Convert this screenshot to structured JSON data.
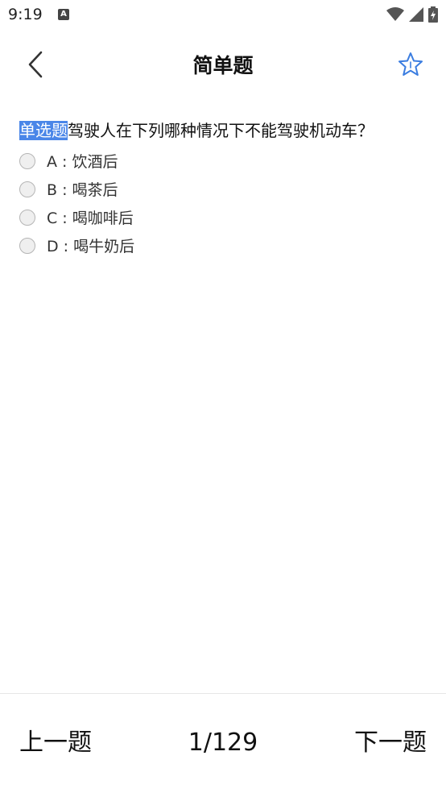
{
  "status_bar": {
    "time": "9:19",
    "notification_icon": "A"
  },
  "header": {
    "title": "简单题",
    "back_icon": "chevron-left",
    "favorite_icon": "star-outline"
  },
  "question": {
    "type_label": "单选题",
    "text": "驾驶人在下列哪种情况下不能驾驶机动车？",
    "options": [
      {
        "label": "A : 饮酒后"
      },
      {
        "label": "B : 喝茶后"
      },
      {
        "label": "C : 喝咖啡后"
      },
      {
        "label": "D : 喝牛奶后"
      }
    ]
  },
  "footer": {
    "prev_label": "上一题",
    "page_indicator": "1/129",
    "next_label": "下一题"
  },
  "colors": {
    "accent": "#4a86e8",
    "star": "#3b7de0"
  }
}
